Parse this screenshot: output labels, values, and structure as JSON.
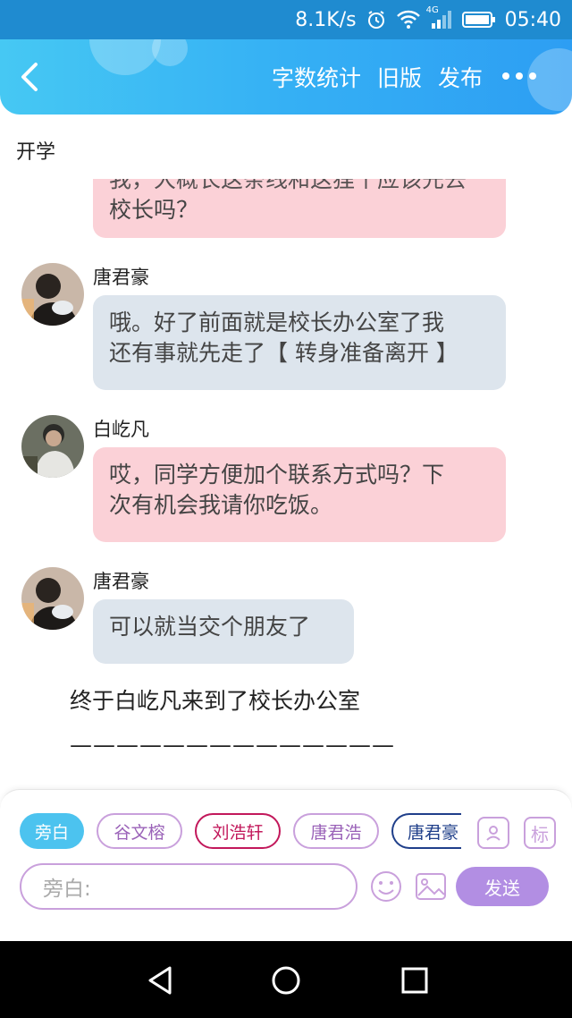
{
  "status_bar": {
    "speed": "8.1K/s",
    "network": "4G",
    "time": "05:40"
  },
  "header": {
    "actions": [
      "字数统计",
      "旧版",
      "发布"
    ],
    "gradient": [
      "#46c8f3",
      "#2d9ef3"
    ]
  },
  "story": {
    "title": "开学"
  },
  "messages": [
    {
      "type": "partial",
      "speaker": "",
      "side": "pink",
      "lines": [
        "我，大概长这条线和这狸个应该先去",
        "校长吗？"
      ]
    },
    {
      "type": "msg",
      "speaker": "唐君豪",
      "avatar": "avatar-tang",
      "side": "gray",
      "lines": [
        "哦。好了前面就是校长办公室了我",
        "还有事就先走了【 转身准备离开 】"
      ]
    },
    {
      "type": "msg",
      "speaker": "白屹凡",
      "avatar": "avatar-bai",
      "side": "pink",
      "lines": [
        "哎，同学方便加个联系方式吗？下",
        "次有机会我请你吃饭。"
      ]
    },
    {
      "type": "msg",
      "speaker": "唐君豪",
      "avatar": "avatar-tang",
      "side": "gray",
      "lines": [
        "可以就当交个朋友了"
      ]
    }
  ],
  "narration": {
    "text": "终于白屹凡来到了校长办公室",
    "dashes": "——————————————"
  },
  "composer": {
    "chips": [
      {
        "label": "旁白",
        "style": "filled",
        "color": "#4cc3ef"
      },
      {
        "label": "谷文榕",
        "style": "outline",
        "color": "#c9a0dc"
      },
      {
        "label": "刘浩轩",
        "style": "outline",
        "color": "#c2185b"
      },
      {
        "label": "唐君浩",
        "style": "outline",
        "color": "#c9a0dc"
      },
      {
        "label": "唐君豪",
        "style": "outline",
        "color": "#1f3f8a"
      }
    ],
    "tag_button": "标",
    "input_placeholder": "旁白:",
    "send_label": "发送",
    "accent": "#b28ee3"
  },
  "icons": [
    "back-arrow-icon",
    "more-dots-icon",
    "person-card-icon",
    "emoji-icon",
    "image-icon",
    "nav-back-icon",
    "nav-home-icon",
    "nav-recent-icon"
  ]
}
